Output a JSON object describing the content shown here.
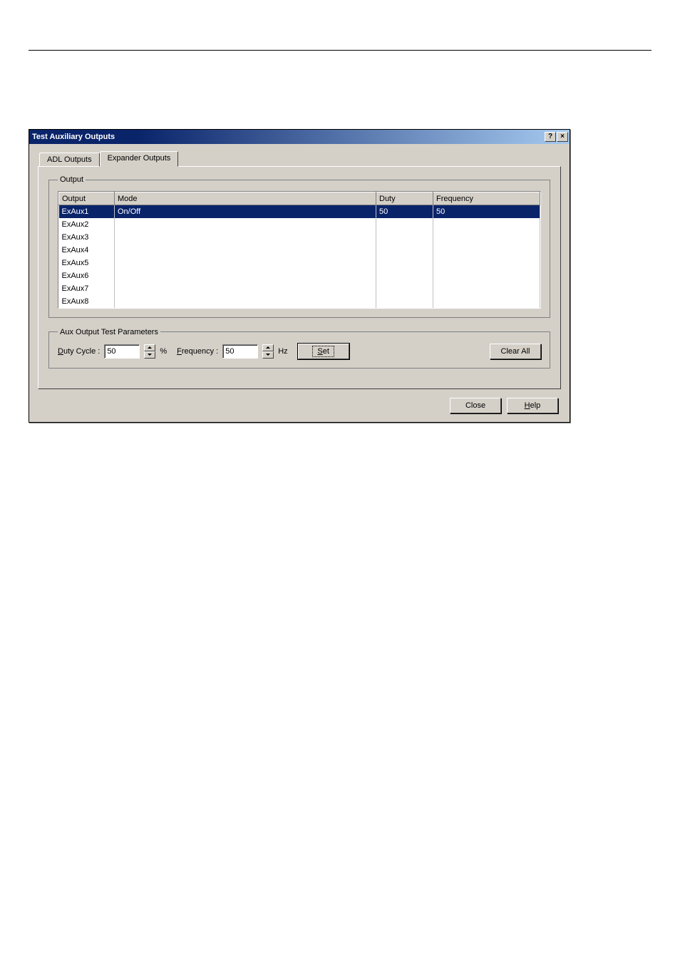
{
  "window": {
    "title": "Test Auxiliary Outputs",
    "help_btn": "?",
    "close_btn": "×"
  },
  "tabs": {
    "adl": "ADL Outputs",
    "expander": "Expander Outputs"
  },
  "output_group": {
    "legend": "Output",
    "columns": {
      "output": "Output",
      "mode": "Mode",
      "duty": "Duty",
      "frequency": "Frequency"
    },
    "rows": [
      {
        "output": "ExAux1",
        "mode": "On/Off",
        "duty": "50",
        "frequency": "50",
        "selected": true
      },
      {
        "output": "ExAux2",
        "mode": "",
        "duty": "",
        "frequency": "",
        "selected": false
      },
      {
        "output": "ExAux3",
        "mode": "",
        "duty": "",
        "frequency": "",
        "selected": false
      },
      {
        "output": "ExAux4",
        "mode": "",
        "duty": "",
        "frequency": "",
        "selected": false
      },
      {
        "output": "ExAux5",
        "mode": "",
        "duty": "",
        "frequency": "",
        "selected": false
      },
      {
        "output": "ExAux6",
        "mode": "",
        "duty": "",
        "frequency": "",
        "selected": false
      },
      {
        "output": "ExAux7",
        "mode": "",
        "duty": "",
        "frequency": "",
        "selected": false
      },
      {
        "output": "ExAux8",
        "mode": "",
        "duty": "",
        "frequency": "",
        "selected": false
      }
    ]
  },
  "params": {
    "legend": "Aux Output Test Parameters",
    "duty_label_pre": "D",
    "duty_label_post": "uty Cycle :",
    "duty_value": "50",
    "duty_unit": "%",
    "freq_label_pre": "F",
    "freq_label_post": "requency :",
    "freq_value": "50",
    "freq_unit": "Hz",
    "set_pre": "S",
    "set_post": "et",
    "clear_all": "Clear All"
  },
  "buttons": {
    "close": "Close",
    "help_pre": "H",
    "help_post": "elp"
  }
}
